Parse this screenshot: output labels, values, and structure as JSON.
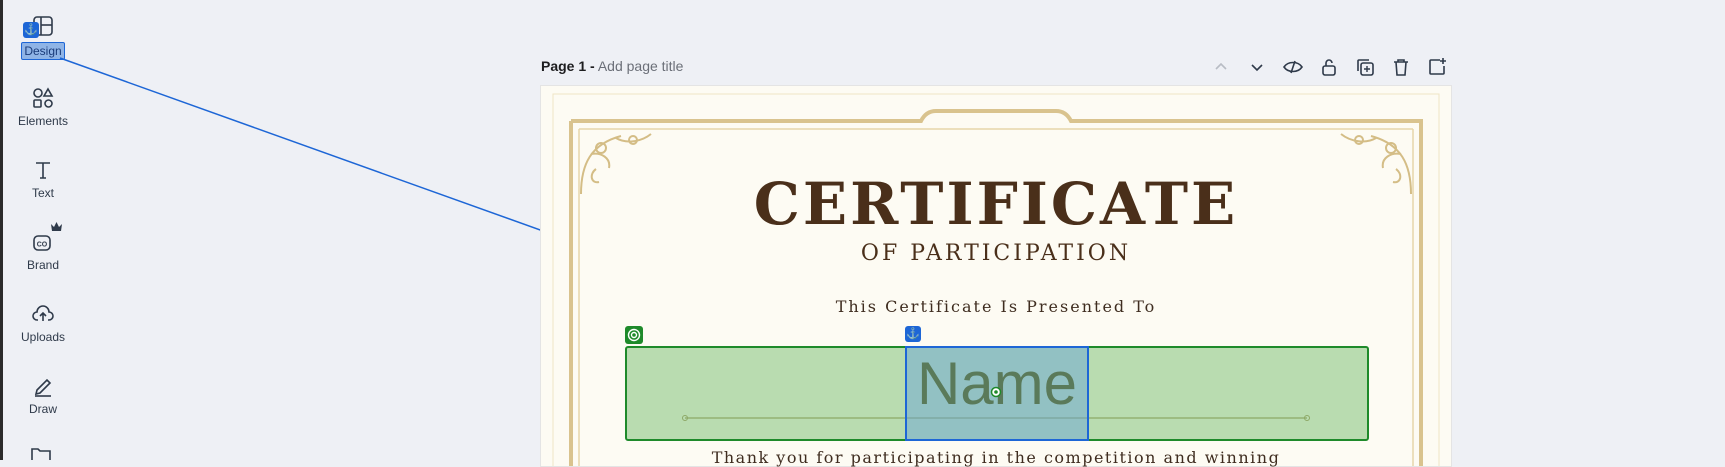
{
  "sidebar": {
    "items": [
      {
        "label": "Design",
        "icon": "design-icon"
      },
      {
        "label": "Elements",
        "icon": "elements-icon"
      },
      {
        "label": "Text",
        "icon": "text-icon"
      },
      {
        "label": "Brand",
        "icon": "brand-icon"
      },
      {
        "label": "Uploads",
        "icon": "uploads-icon"
      },
      {
        "label": "Draw",
        "icon": "draw-icon"
      }
    ]
  },
  "page": {
    "label": "Page 1 -",
    "title_placeholder": "Add page title"
  },
  "toolbar": {
    "icons": [
      "chevron-up-icon",
      "chevron-down-icon",
      "hide-icon",
      "lock-icon",
      "duplicate-icon",
      "trash-icon",
      "add-page-icon"
    ]
  },
  "certificate": {
    "title": "CERTIFICATE",
    "subtitle": "OF PARTICIPATION",
    "presented": "This Certificate Is Presented To",
    "name_placeholder": "Name",
    "thanks": "Thank you for participating in the competition and winning"
  },
  "colors": {
    "selection_blue": "#1d66d6",
    "selection_green": "#1e8a2a",
    "cert_brown": "#4a2f1a",
    "frame_gold": "#d9c38e"
  }
}
